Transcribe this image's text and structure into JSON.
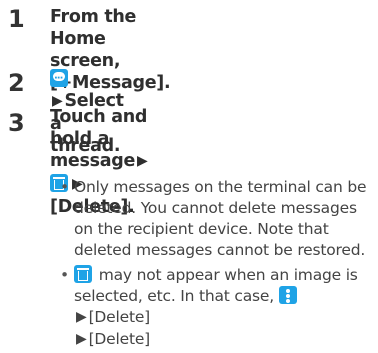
{
  "steps": [
    {
      "number": "1",
      "line1": "From the Home screen,",
      "line2": "[+Message]."
    },
    {
      "number": "2",
      "text": "Select a thread."
    },
    {
      "number": "3",
      "line1_a": "Touch and hold a message",
      "line2": "[Delete]."
    }
  ],
  "arrow": "▶",
  "notes": {
    "note1": [
      "Only messages on the terminal can be",
      "deleted. You cannot delete messages",
      "on the recipient device. Note that",
      "deleted messages cannot be restored."
    ],
    "note2_a": "may not appear when an image is",
    "note2_b": "selected, etc. In that case,",
    "note2_c": "[Delete]",
    "note2_d": "[Delete]"
  },
  "icons": {
    "message": "message-icon",
    "trash": "trash-icon",
    "menu": "menu-icon"
  },
  "colors": {
    "icon_blue": "#1fa3e6"
  }
}
